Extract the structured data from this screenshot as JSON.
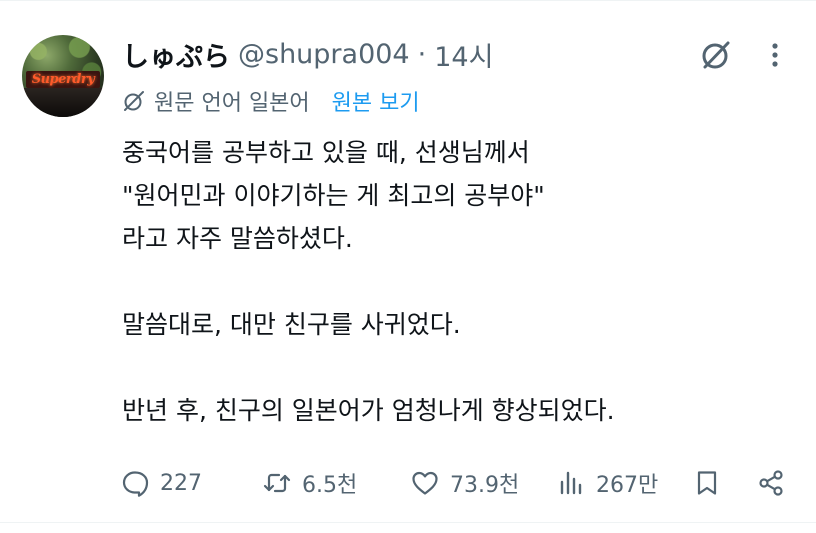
{
  "author": {
    "display_name": "しゅぷら",
    "handle": "@shupra004",
    "separator": "·",
    "time": "14시",
    "avatar_sign_text": "Superdry"
  },
  "translation": {
    "label": "원문 언어 일본어",
    "view_original": "원본 보기"
  },
  "body": {
    "lines": [
      "중국어를 공부하고 있을 때, 선생님께서",
      "\"원어민과 이야기하는 게 최고의 공부야\"",
      "라고 자주 말씀하셨다.",
      "",
      "말씀대로, 대만 친구를 사귀었다.",
      "",
      "반년 후, 친구의 일본어가 엄청나게 향상되었다."
    ]
  },
  "actions": {
    "replies": "227",
    "retweets": "6.5천",
    "likes": "73.9천",
    "views": "267만"
  },
  "icons": {
    "grok": "grok-icon",
    "more": "more-icon",
    "translate": "translate-icon",
    "reply": "reply-icon",
    "retweet": "retweet-icon",
    "like": "heart-icon",
    "views": "views-chart-icon",
    "bookmark": "bookmark-icon",
    "share": "share-icon"
  },
  "colors": {
    "text": "#0f1419",
    "secondary": "#536471",
    "link": "#1d9bf0",
    "divider": "#eff3f4"
  }
}
